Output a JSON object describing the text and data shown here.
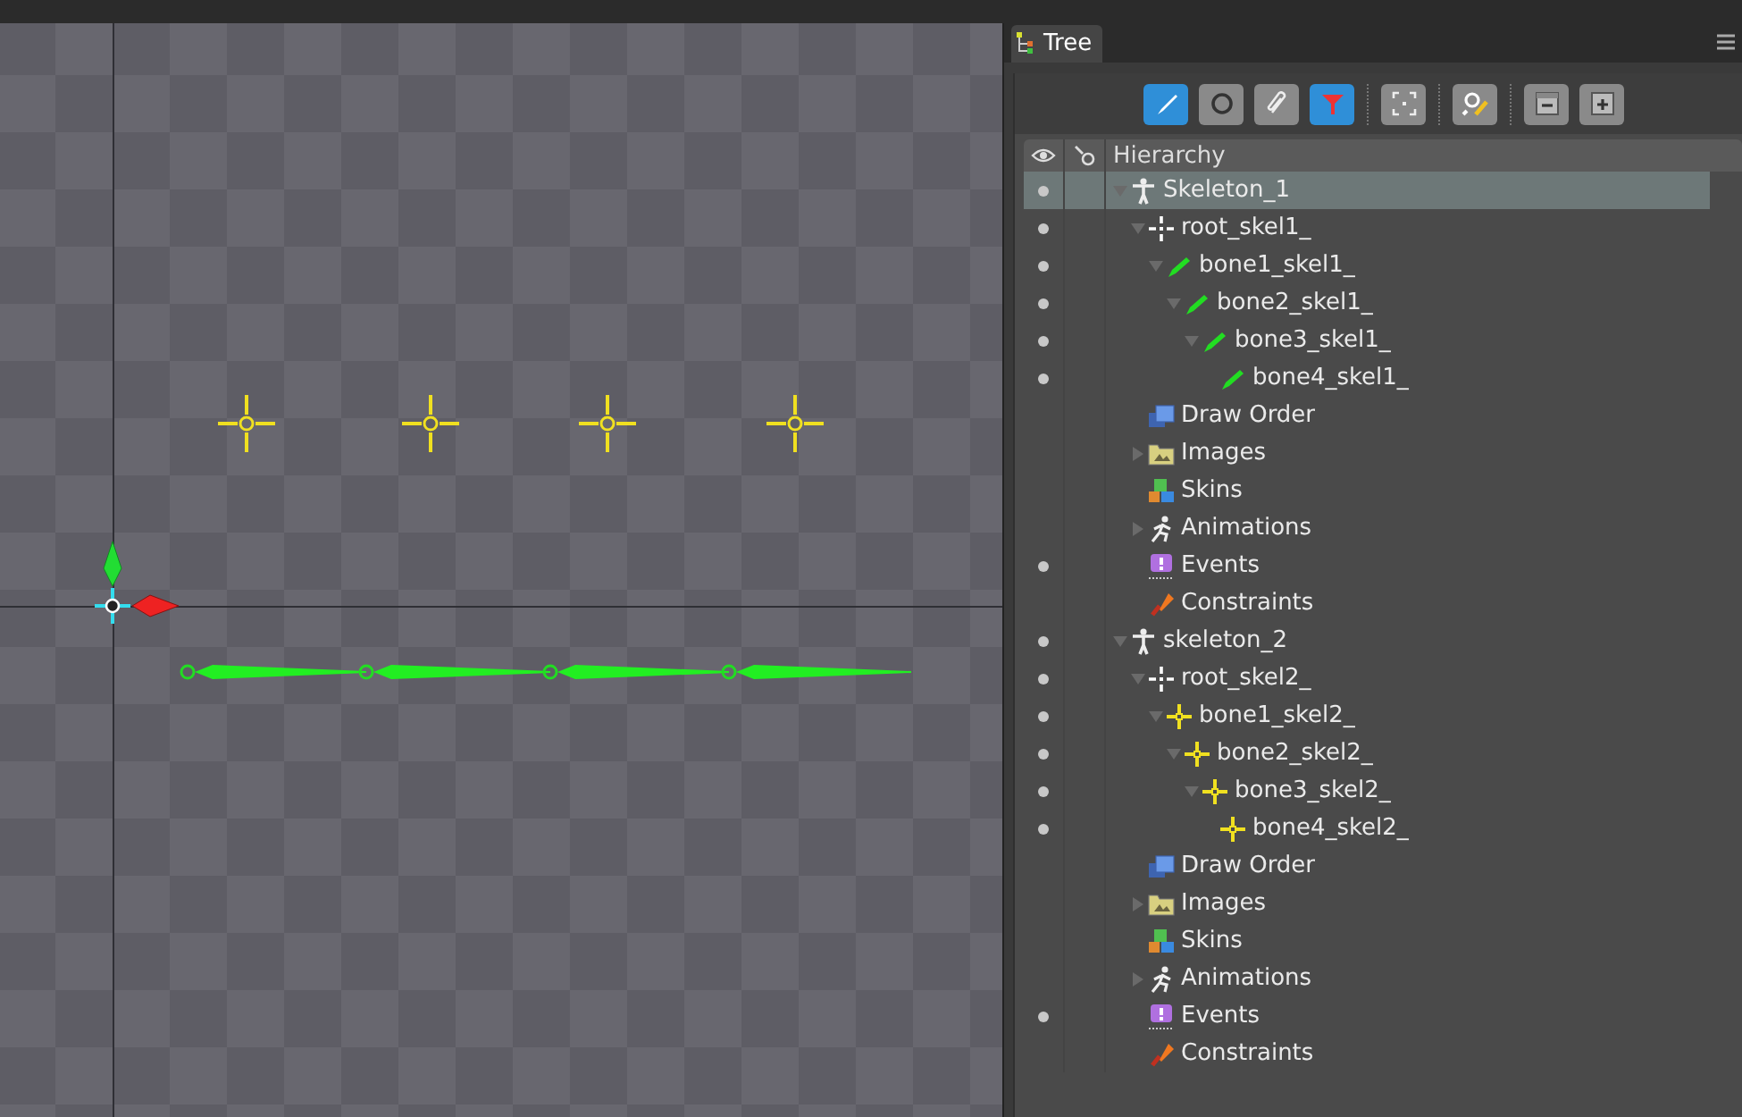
{
  "panel": {
    "tab": {
      "label": "Tree",
      "selected": true
    },
    "toolbar": [
      [
        {
          "selected": true
        },
        {
          "selected": false
        },
        {
          "selected": false
        },
        {
          "selected": true
        }
      ],
      [
        {
          "selected": false
        }
      ],
      [
        {
          "selected": false
        }
      ],
      [
        {
          "selected": false
        },
        {
          "selected": false
        }
      ]
    ],
    "header": {
      "label": "Hierarchy"
    },
    "tree": [
      {
        "label": "Skeleton_1",
        "kind": "skeleton",
        "expanded": true,
        "visible": true,
        "selected": true,
        "children": [
          {
            "label": "root_skel1_",
            "kind": "root",
            "expanded": true,
            "visible": true,
            "selected": false,
            "children": [
              {
                "label": "bone1_skel1_",
                "kind": "bone",
                "expanded": true,
                "visible": true,
                "selected": false,
                "children": [
                  {
                    "label": "bone2_skel1_",
                    "kind": "bone",
                    "expanded": true,
                    "visible": true,
                    "selected": false,
                    "children": [
                      {
                        "label": "bone3_skel1_",
                        "kind": "bone",
                        "expanded": true,
                        "visible": true,
                        "selected": false,
                        "children": [
                          {
                            "label": "bone4_skel1_",
                            "kind": "bone",
                            "visible": true,
                            "selected": false
                          }
                        ]
                      }
                    ]
                  }
                ]
              }
            ]
          },
          {
            "label": "Draw Order",
            "kind": "draw-order",
            "visible": false,
            "selected": false
          },
          {
            "label": "Images",
            "kind": "images",
            "expanded": false,
            "visible": false,
            "selected": false
          },
          {
            "label": "Skins",
            "kind": "skins",
            "visible": false,
            "selected": false
          },
          {
            "label": "Animations",
            "kind": "animations",
            "expanded": false,
            "visible": false,
            "selected": false
          },
          {
            "label": "Events",
            "kind": "events",
            "visible": true,
            "selected": false
          },
          {
            "label": "Constraints",
            "kind": "constraints",
            "visible": false,
            "selected": false
          }
        ]
      },
      {
        "label": "skeleton_2",
        "kind": "skeleton",
        "expanded": true,
        "visible": true,
        "selected": false,
        "children": [
          {
            "label": "root_skel2_",
            "kind": "root",
            "expanded": true,
            "visible": true,
            "selected": false,
            "children": [
              {
                "label": "bone1_skel2_",
                "kind": "point-bone",
                "expanded": true,
                "visible": true,
                "selected": false,
                "children": [
                  {
                    "label": "bone2_skel2_",
                    "kind": "point-bone",
                    "expanded": true,
                    "visible": true,
                    "selected": false,
                    "children": [
                      {
                        "label": "bone3_skel2_",
                        "kind": "point-bone",
                        "expanded": true,
                        "visible": true,
                        "selected": false,
                        "children": [
                          {
                            "label": "bone4_skel2_",
                            "kind": "point-bone",
                            "visible": true,
                            "selected": false
                          }
                        ]
                      }
                    ]
                  }
                ]
              }
            ]
          },
          {
            "label": "Draw Order",
            "kind": "draw-order",
            "visible": false,
            "selected": false
          },
          {
            "label": "Images",
            "kind": "images",
            "expanded": false,
            "visible": false,
            "selected": false
          },
          {
            "label": "Skins",
            "kind": "skins",
            "visible": false,
            "selected": false
          },
          {
            "label": "Animations",
            "kind": "animations",
            "expanded": false,
            "visible": false,
            "selected": false
          },
          {
            "label": "Events",
            "kind": "events",
            "visible": true,
            "selected": false
          },
          {
            "label": "Constraints",
            "kind": "constraints",
            "visible": false,
            "selected": false
          }
        ]
      }
    ]
  }
}
